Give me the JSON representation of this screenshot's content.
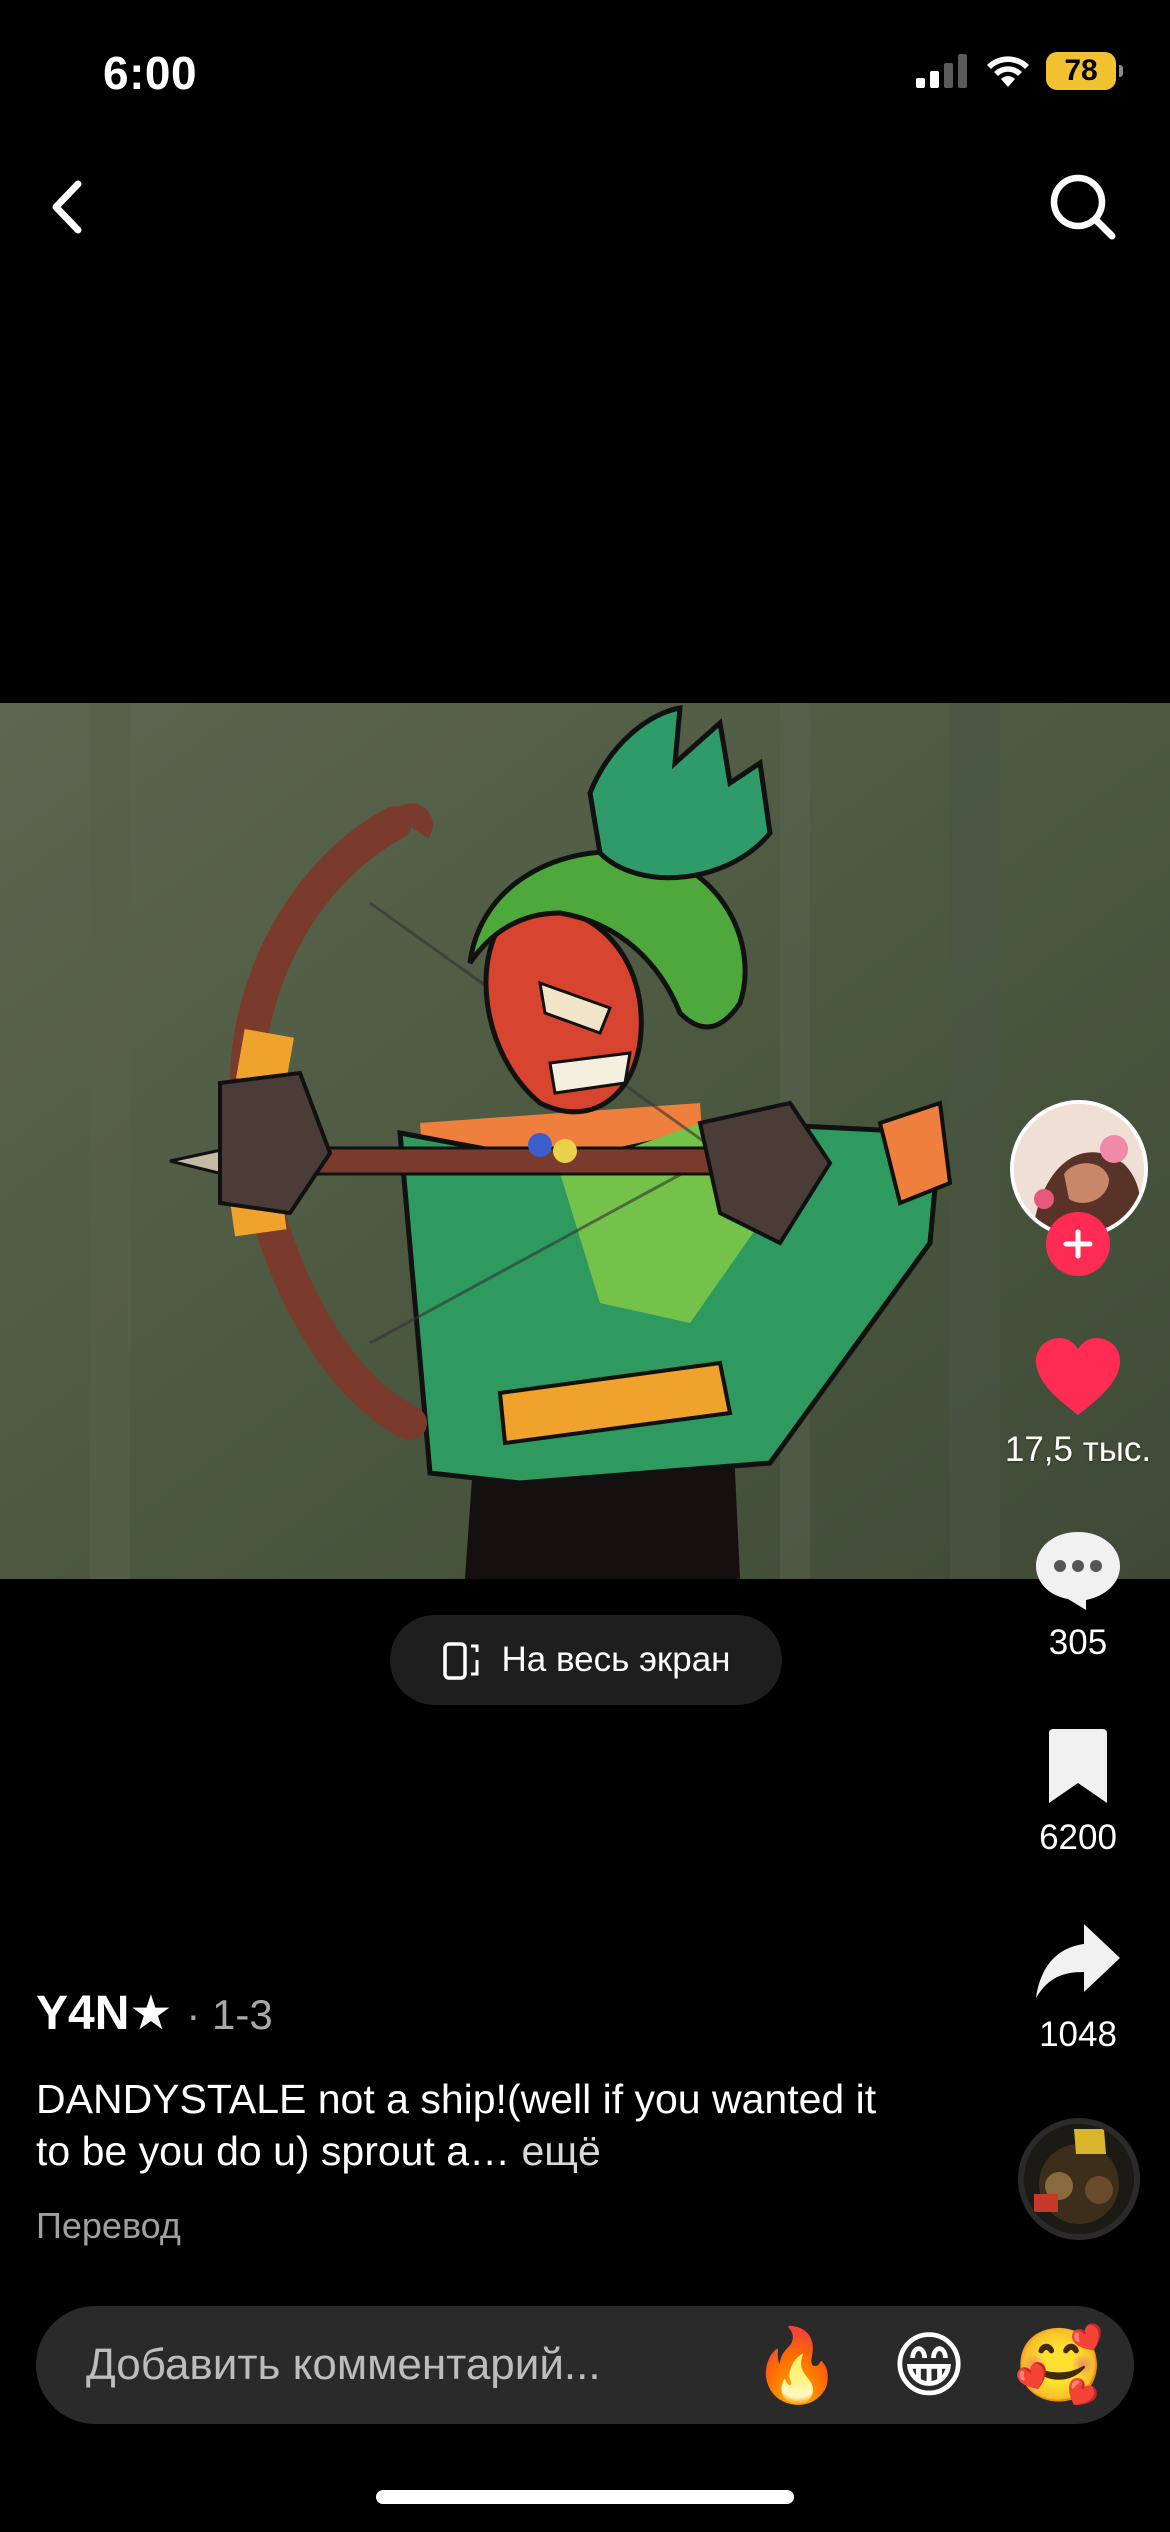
{
  "status_bar": {
    "time": "6:00",
    "battery": "78"
  },
  "nav": {
    "back_icon": "chevron-left-icon",
    "search_icon": "search-icon"
  },
  "video": {
    "fullscreen_label": "На весь экран"
  },
  "actions": {
    "likes": "17,5 тыс.",
    "comments": "305",
    "saves": "6200",
    "shares": "1048",
    "like_color": "#fe2c55",
    "follow_color": "#fe2c55"
  },
  "post": {
    "author": "Y4N★",
    "meta": "· 1-3",
    "caption": "DANDYSTALE not a ship!(well if you wanted it to be you do u) sprout a…",
    "more": "ещё",
    "translate": "Перевод"
  },
  "comment": {
    "placeholder": "Добавить комментарий...",
    "emojis": [
      "🔥",
      "😁",
      "🥰"
    ]
  }
}
